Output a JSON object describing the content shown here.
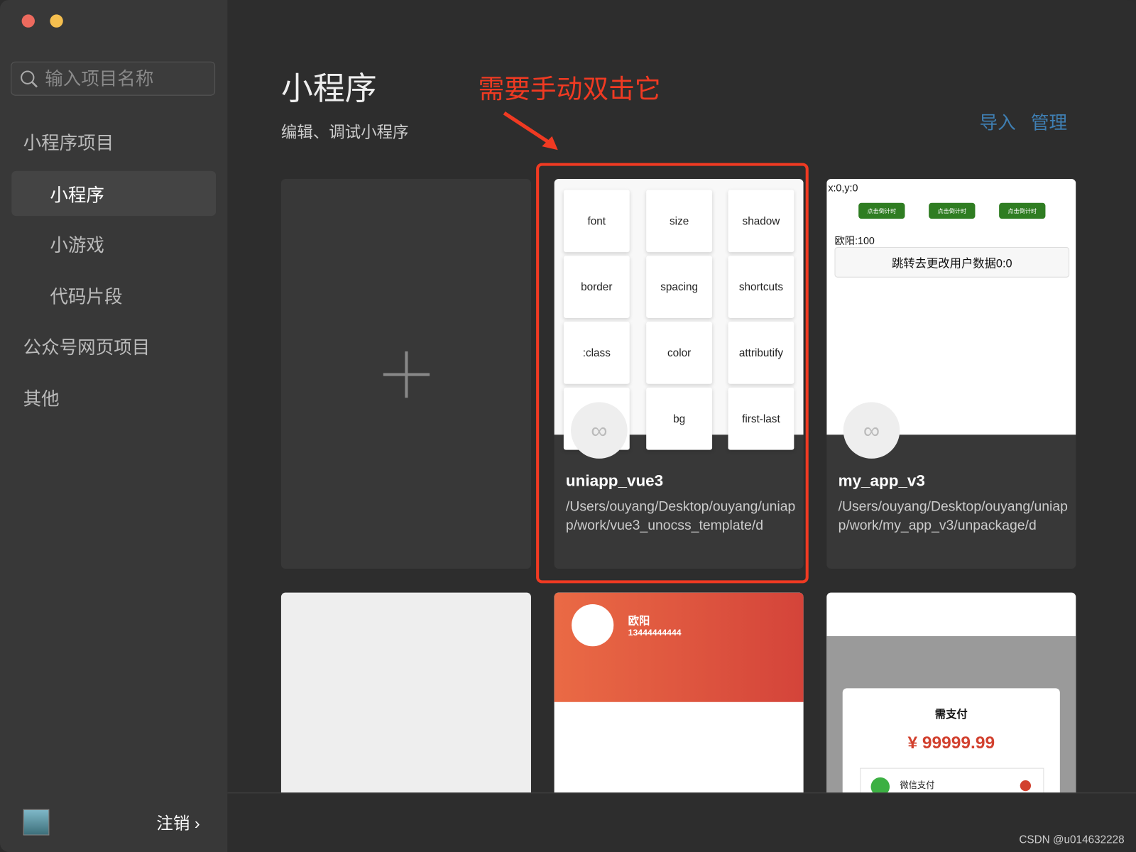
{
  "window": {
    "close_color": "#ed6a5e",
    "minimize_color": "#f5bf4f"
  },
  "sidebar": {
    "search_placeholder": "输入项目名称",
    "sections": [
      {
        "label": "小程序项目"
      },
      {
        "label": "公众号网页项目"
      },
      {
        "label": "其他"
      }
    ],
    "items": [
      {
        "label": "小程序",
        "selected": true
      },
      {
        "label": "小游戏"
      },
      {
        "label": "代码片段"
      }
    ],
    "logout_label": "注销"
  },
  "header": {
    "title": "小程序",
    "subtitle": "编辑、调试小程序",
    "import_label": "导入",
    "manage_label": "管理"
  },
  "annotation": {
    "text": "需要手动双击它",
    "color": "#f03a22"
  },
  "projects": [
    {
      "name": "uniapp_vue3",
      "path": "/Users/ouyang/Desktop/ouyang/uniapp/work/vue3_unocss_template/d",
      "tiles": [
        "font",
        "size",
        "shadow",
        "border",
        "spacing",
        "shortcuts",
        ":class",
        "color",
        "attributify",
        "",
        "bg",
        "first-last"
      ]
    },
    {
      "name": "my_app_v3",
      "path": "/Users/ouyang/Desktop/ouyang/uniapp/work/my_app_v3/unpackage/d",
      "coords": "x:0,y:0",
      "buttons": [
        "点击倒计时",
        "点击倒计时",
        "点击倒计时"
      ],
      "user_line": "欧阳:100",
      "jump_button": "跳转去更改用户数据0:0"
    }
  ],
  "row2": {
    "profile_name": "欧阳",
    "profile_phone": "13444444444",
    "pay_title": "需支付",
    "pay_amount": "¥ 99999.99",
    "pay_method": "微信支付"
  },
  "watermark": "CSDN @u014632228"
}
